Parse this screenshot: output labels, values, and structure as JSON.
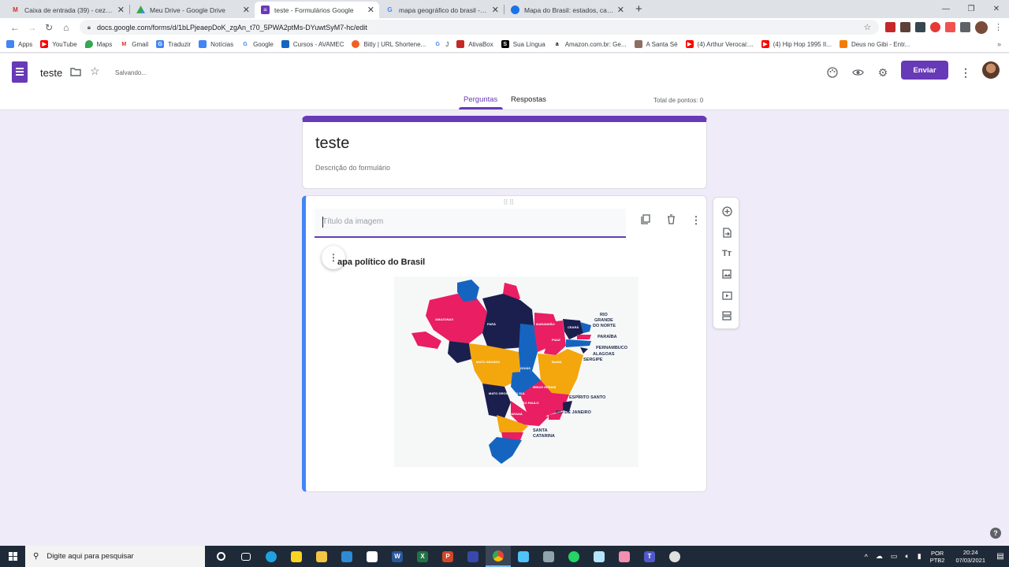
{
  "browser": {
    "tabs": [
      {
        "title": "Caixa de entrada (39) - cezarsant",
        "icon": "gmail-icon",
        "color": "#d93025"
      },
      {
        "title": "Meu Drive - Google Drive",
        "icon": "drive-icon",
        "color": "#1e8e3e"
      },
      {
        "title": "teste - Formulários Google",
        "icon": "forms-icon",
        "color": "#673ab7"
      },
      {
        "title": "mapa geográfico do brasil - Pesq",
        "icon": "google-icon",
        "color": "#4285f4"
      },
      {
        "title": "Mapa do Brasil: estados, capitais",
        "icon": "globe-icon",
        "color": "#1a73e8"
      }
    ],
    "active_tab": 2,
    "url": "docs.google.com/forms/d/1bLPjeaepDoK_zgAn_t70_5PWA2ptMs-DYuwtSyM7-hc/edit",
    "bookmarks": [
      "Apps",
      "YouTube",
      "Maps",
      "Gmail",
      "Traduzir",
      "Notícias",
      "Google",
      "Cursos - AVAMEC",
      "Bitly | URL Shortene...",
      "J",
      "AtivaBox",
      "Sua Língua",
      "Amazon.com.br: Ge...",
      "A Santa Sé",
      "(4) Arthur Verocai:...",
      "(4) Hip Hop 1995 II...",
      "Deus no Gibi - Entr..."
    ]
  },
  "header": {
    "form_name": "teste",
    "status": "Salvando...",
    "send_label": "Enviar",
    "tabs": [
      "Perguntas",
      "Respostas"
    ],
    "points": "Total de pontos: 0"
  },
  "form": {
    "title": "teste",
    "description": "Descrição do formulário"
  },
  "image_item": {
    "title_placeholder": "Título da imagem",
    "image_heading": "apa político do Brasil",
    "map_labels": {
      "para": "PARÁ",
      "amazonas": "AMAZONAS",
      "maranhao": "MARANHÃO",
      "piaui": "PIAUÍ",
      "ceara": "CEARÁ",
      "bahia": "BAHIA",
      "mato_grosso": "MATO GROSSO",
      "goias": "GOIÁS",
      "minas": "MINAS GERAIS",
      "ms": "MATO GROSSO DO SUL",
      "sp": "SÃO PAULO",
      "parana": "PARANÁ",
      "rn_1": "RIO",
      "rn_2": "GRANDE",
      "rn_3": "DO NORTE",
      "paraiba": "PARAÍBA",
      "pernambuco": "PERNAMBUCO",
      "alagoas": "ALAGOAS",
      "sergipe": "SERGIPE",
      "es": "ESPÍRITO SANTO",
      "rj": "RIO DE JANEIRO",
      "sc_1": "SANTA",
      "sc_2": "CATARINA"
    }
  },
  "taskbar": {
    "search_placeholder": "Digite aqui para pesquisar",
    "lang_1": "POR",
    "lang_2": "PTB2",
    "time": "20:24",
    "date": "07/03/2021"
  }
}
